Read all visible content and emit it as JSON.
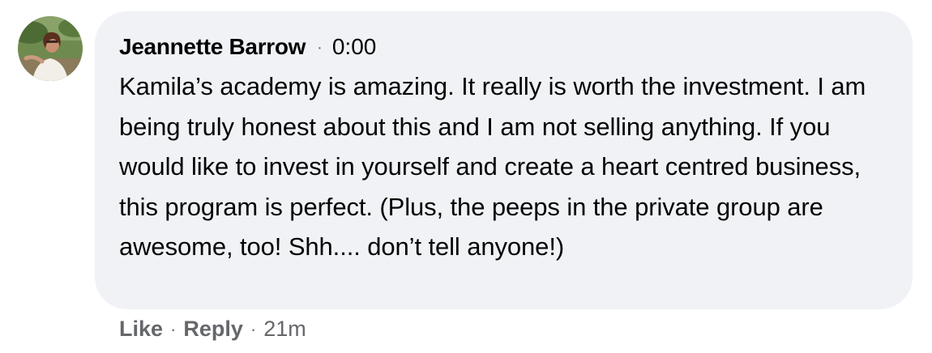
{
  "comment": {
    "author": "Jeannette Barrow",
    "separator": "·",
    "timestamp": "0:00",
    "text": "Kamila’s academy is amazing. It really is worth the investment. I am being truly honest about this and I am not selling anything. If you would like to invest in yourself and create a heart centred business, this program is perfect. (Plus, the peeps in the private group are awesome, too! Shh.... don’t tell anyone!)"
  },
  "actions": {
    "like_label": "Like",
    "reply_label": "Reply",
    "separator": "·",
    "age": "21m"
  },
  "colors": {
    "bubble_bg": "#f0f2f5",
    "text": "#050505",
    "secondary_text": "#65676b"
  }
}
